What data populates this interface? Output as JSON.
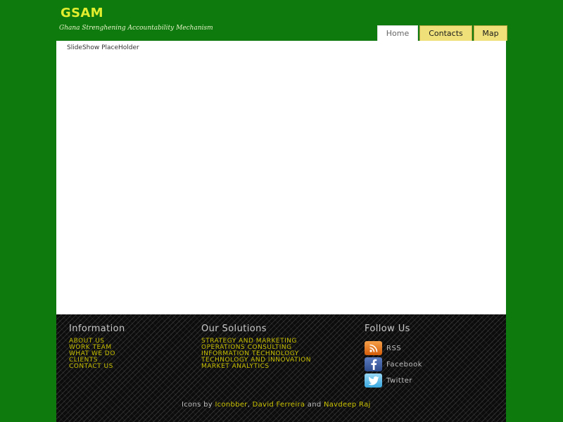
{
  "header": {
    "logo": "GSAM",
    "tagline": "Ghana Strenghening Accountability Mechanism"
  },
  "nav": {
    "tabs": [
      {
        "label": "Home",
        "active": true
      },
      {
        "label": "Contacts",
        "active": false
      },
      {
        "label": "Map",
        "active": false
      }
    ]
  },
  "main": {
    "slideshow": "SlideShow PlaceHolder"
  },
  "footer": {
    "information": {
      "heading": "Information",
      "links": [
        "ABOUT US",
        "WORK TEAM",
        "WHAT WE DO",
        "CLIENTS",
        "CONTACT US"
      ]
    },
    "solutions": {
      "heading": "Our Solutions",
      "links": [
        "STRATEGY AND MARKETING",
        "OPERATIONS CONSULTING",
        "INFORMATION TECHNOLOGY",
        "TECHNOLOGY AND INNOVATION",
        "MARKET ANALYTICS"
      ]
    },
    "follow": {
      "heading": "Follow Us",
      "items": [
        {
          "label": "RSS",
          "icon": "rss-icon"
        },
        {
          "label": "Facebook",
          "icon": "facebook-icon"
        },
        {
          "label": "Twitter",
          "icon": "twitter-icon"
        }
      ]
    },
    "credits": {
      "prefix": "Icons by ",
      "link1": "Iconbber",
      "sep1": ", ",
      "link2": "David Ferreira",
      "sep2": " and ",
      "link3": "Navdeep Raj"
    }
  },
  "colors": {
    "page_bg": "#0e7a0e",
    "logo": "#e2ee2e",
    "tab_bg": "#efe07a",
    "footer_link": "#c8c000",
    "footer_bg": "#0c0c0c"
  }
}
